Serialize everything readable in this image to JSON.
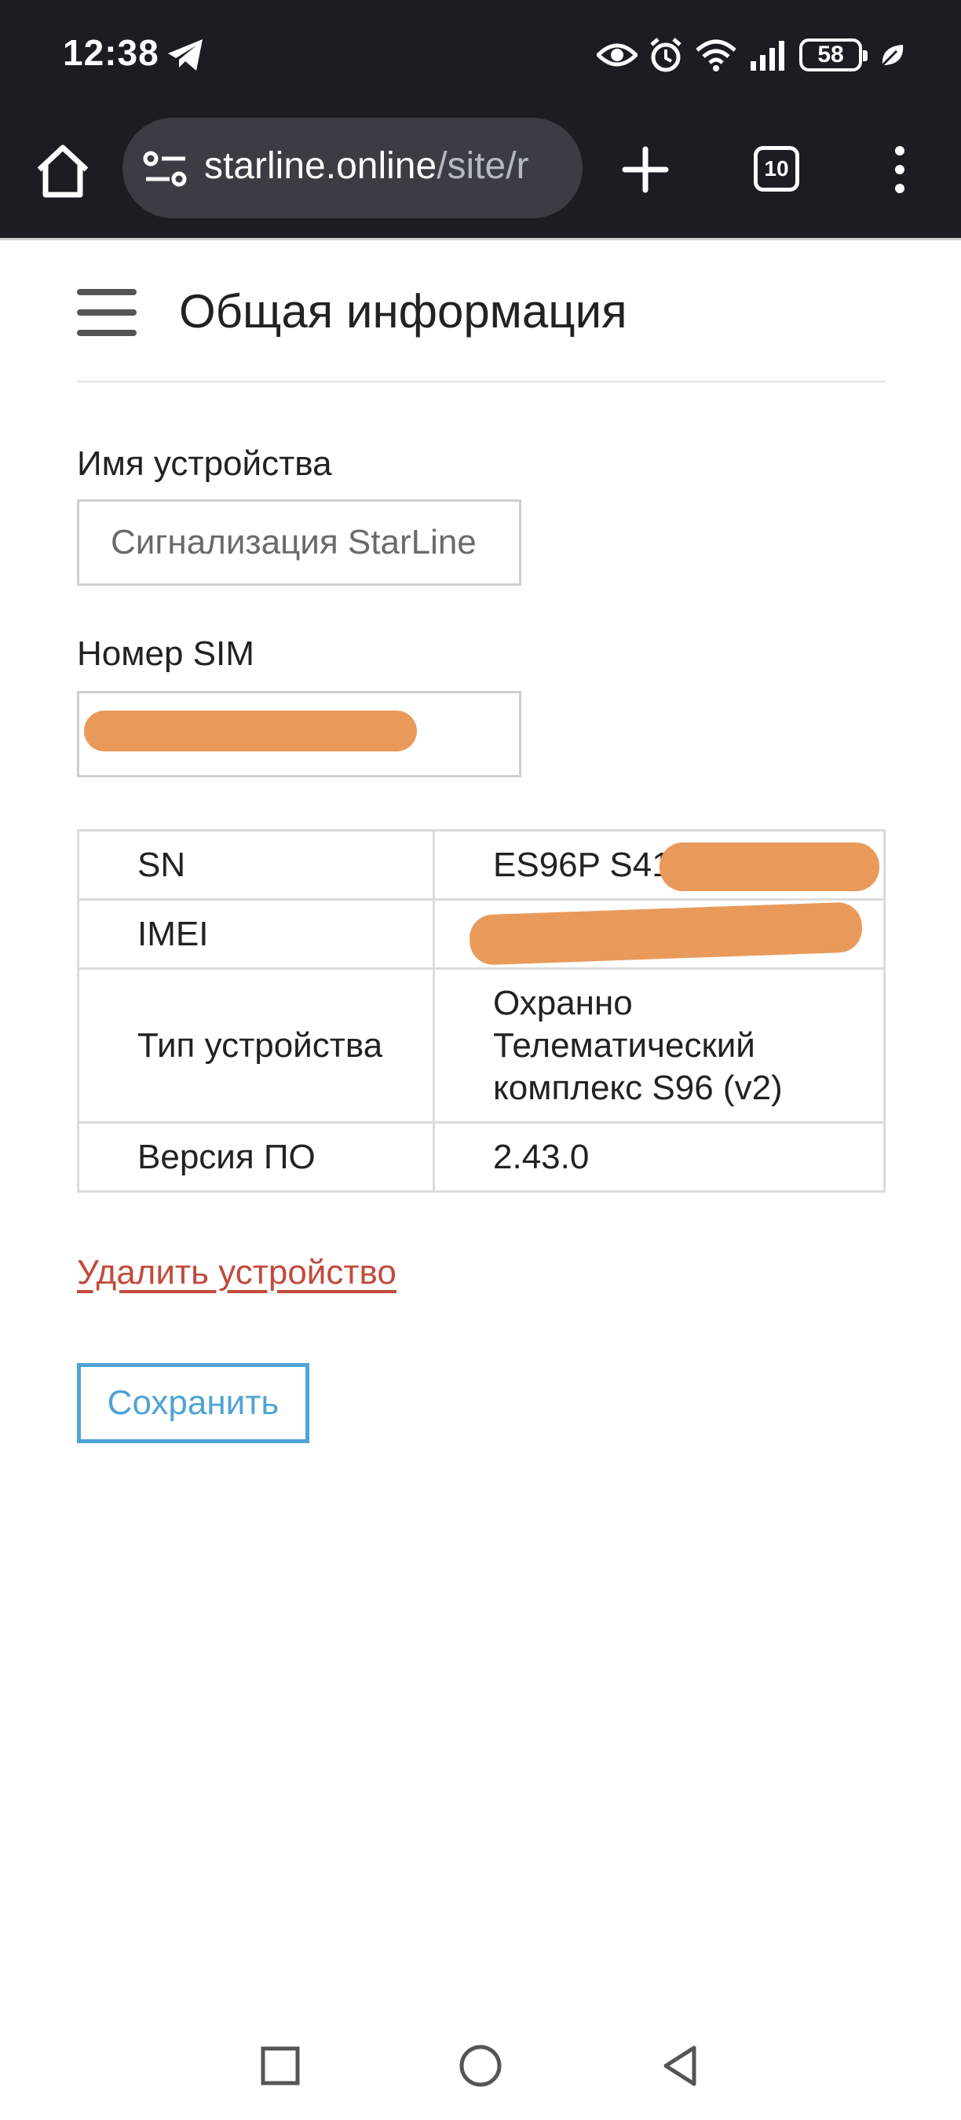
{
  "status_bar": {
    "time": "12:38",
    "battery": "58",
    "icons": [
      "telegram-icon",
      "eye-icon",
      "alarm-icon",
      "wifi-icon",
      "signal-icon",
      "battery-icon",
      "leaf-icon"
    ]
  },
  "browser": {
    "url_host": "starline.online",
    "url_path": "/site/r",
    "tab_count": "10"
  },
  "page": {
    "title": "Общая информация",
    "device_name_label": "Имя устройства",
    "device_name_value": "Сигнализация StarLine",
    "sim_label": "Номер SIM",
    "sim_value": "",
    "table": [
      {
        "key": "SN",
        "value": "ES96P S41"
      },
      {
        "key": "IMEI",
        "value": ""
      },
      {
        "key": "Тип устройства",
        "value": "Охранно Телематический комплекс S96 (v2)"
      },
      {
        "key": "Версия ПО",
        "value": "2.43.0"
      }
    ],
    "delete_link": "Удалить устройство",
    "save_button": "Сохранить"
  },
  "colors": {
    "chrome_bg": "#1b1d22",
    "url_pill": "#3a3d44",
    "link_red": "#c14b3c",
    "save_blue": "#4fa3d6",
    "redaction": "#e99a5a"
  }
}
